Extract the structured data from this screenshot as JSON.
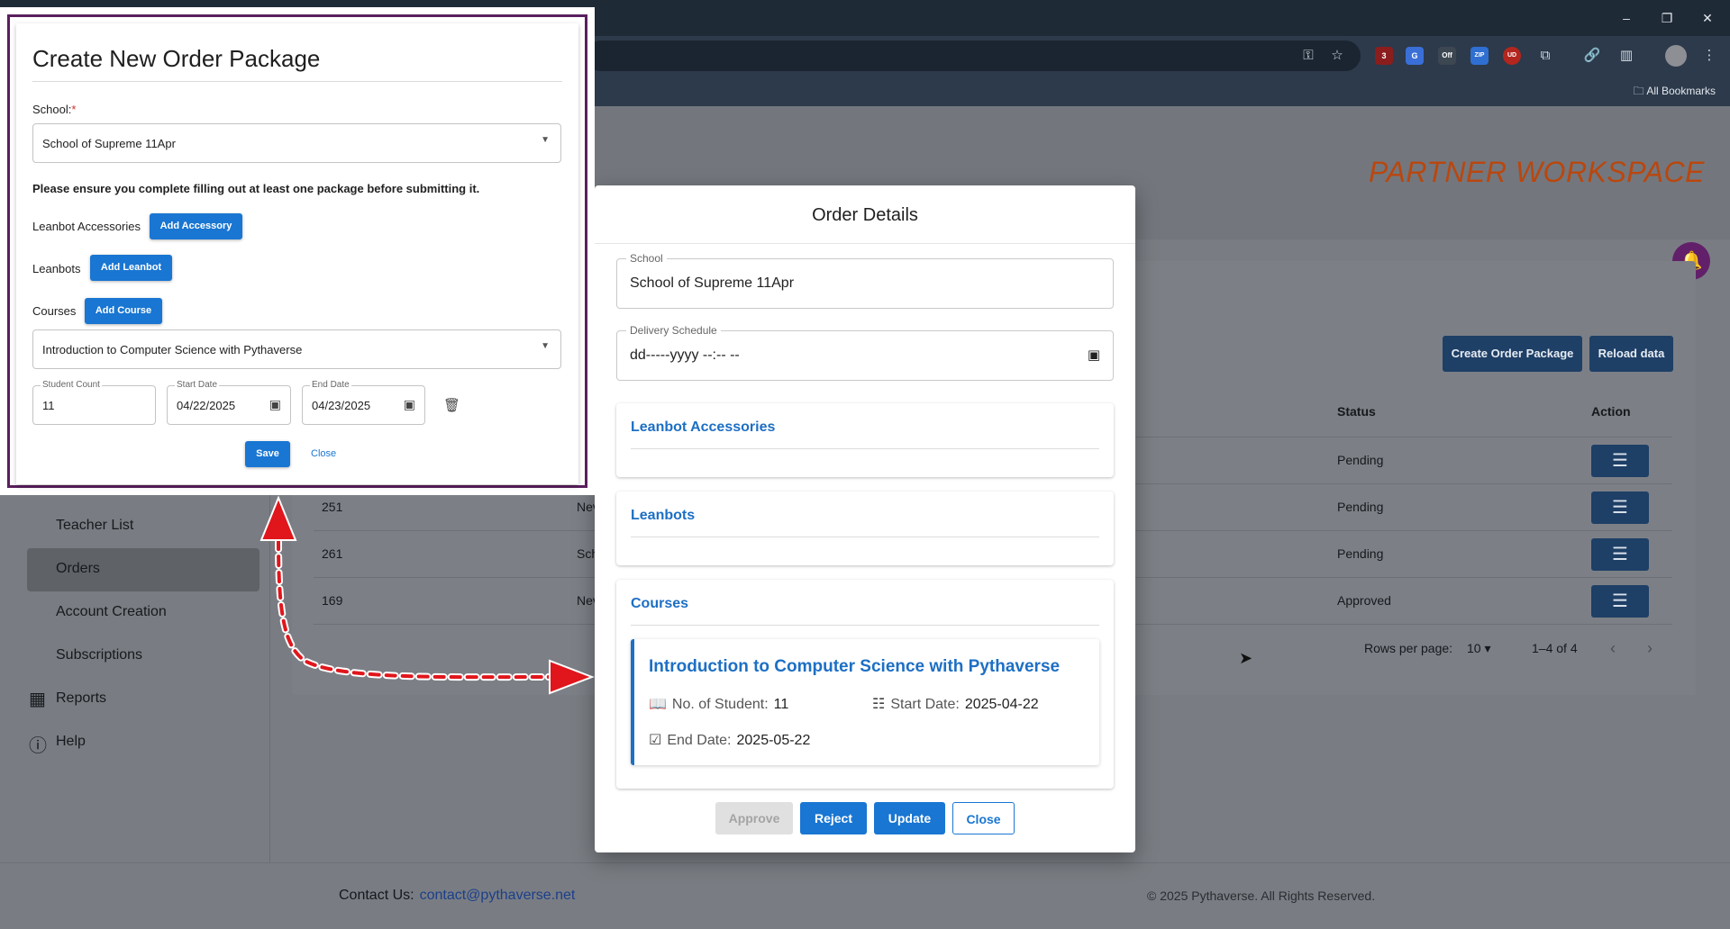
{
  "browser": {
    "window_controls": [
      "–",
      "❐",
      "✕"
    ],
    "bookmarks_label": "All Bookmarks",
    "extensions": [
      "3",
      "G",
      "Off",
      "ZIP",
      "UD"
    ]
  },
  "header": {
    "workspace_title": "PARTNER WORKSPACE"
  },
  "toolbar": {
    "create_label": "Create Order Package",
    "reload_label": "Reload data"
  },
  "table": {
    "columns": [
      "Status",
      "Action"
    ],
    "rows": [
      {
        "id": "",
        "name": "",
        "status": "Pending"
      },
      {
        "id": "251",
        "name": "Nev",
        "status": "Pending"
      },
      {
        "id": "261",
        "name": "Sch",
        "status": "Pending"
      },
      {
        "id": "169",
        "name": "Nev",
        "status": "Approved"
      }
    ],
    "rows_per_page_label": "Rows per page:",
    "rows_per_page_value": "10",
    "range": "1–4 of 4"
  },
  "sidebar": {
    "items": [
      {
        "label": "Teacher List"
      },
      {
        "label": "Orders"
      },
      {
        "label": "Account Creation"
      },
      {
        "label": "Subscriptions"
      },
      {
        "label": "Reports"
      },
      {
        "label": "Help"
      }
    ]
  },
  "footer": {
    "contact_label": "Contact Us:",
    "contact_email": "contact@pythaverse.net",
    "copyright": "© 2025 Pythaverse. All Rights Reserved."
  },
  "order_dialog": {
    "title": "Order Details",
    "school_label": "School",
    "school_value": "School of Supreme 11Apr",
    "delivery_label": "Delivery Schedule",
    "delivery_value": "dd-----yyyy --:-- --",
    "sections": {
      "accessories": "Leanbot Accessories",
      "leanbots": "Leanbots",
      "courses": "Courses"
    },
    "course": {
      "name": "Introduction to Computer Science with Pythaverse",
      "students_label": "No. of Student:",
      "students_value": "11",
      "start_label": "Start Date:",
      "start_value": "2025-04-22",
      "end_label": "End Date:",
      "end_value": "2025-05-22"
    },
    "buttons": {
      "approve": "Approve",
      "reject": "Reject",
      "update": "Update",
      "close": "Close"
    }
  },
  "create_package": {
    "title": "Create New Order Package",
    "school_label": "School:",
    "school_required": "*",
    "school_value": "School of Supreme 11Apr",
    "notice": "Please ensure you complete filling out at least one package before submitting it.",
    "accessories_label": "Leanbot Accessories",
    "add_accessory": "Add Accessory",
    "leanbots_label": "Leanbots",
    "add_leanbot": "Add Leanbot",
    "courses_label": "Courses",
    "add_course": "Add Course",
    "course_value": "Introduction to Computer Science with Pythaverse",
    "student_count_label": "Student Count",
    "student_count_value": "11",
    "start_date_label": "Start Date",
    "start_date_value": "04/22/2025",
    "end_date_label": "End Date",
    "end_date_value": "04/23/2025",
    "save": "Save",
    "close": "Close"
  }
}
